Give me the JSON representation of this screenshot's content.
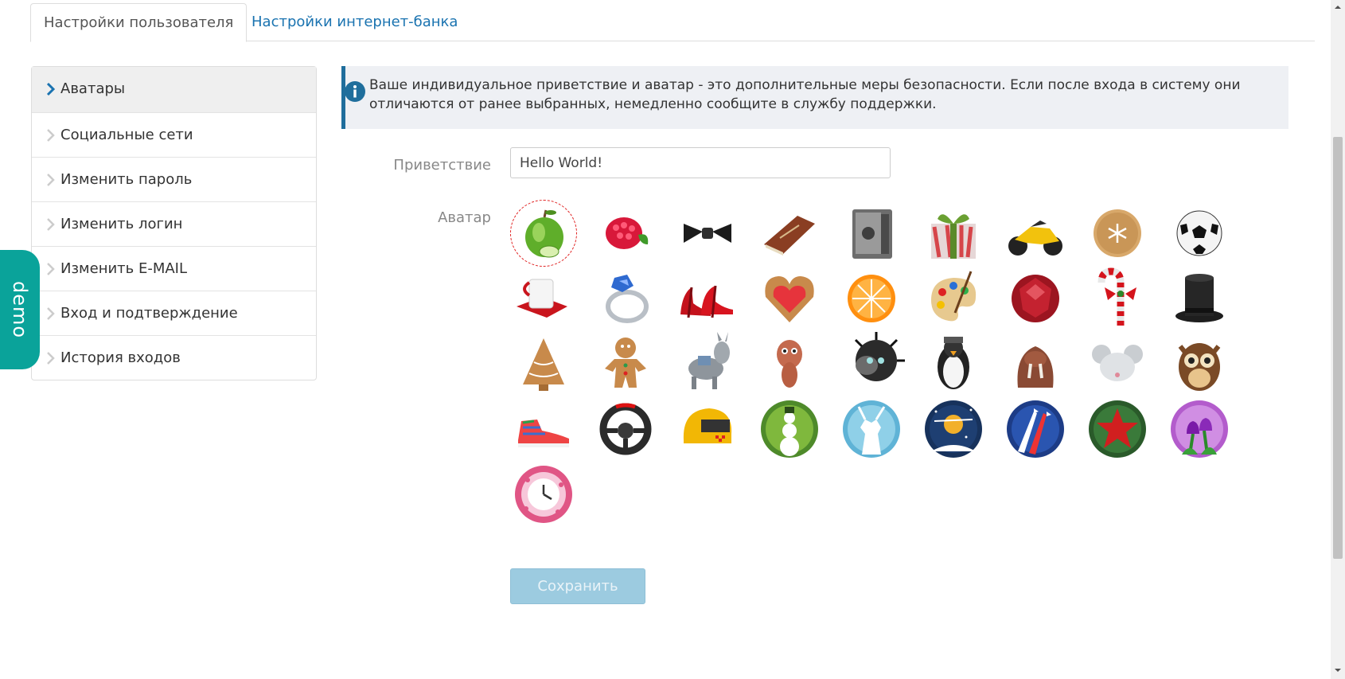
{
  "tabs": [
    {
      "label": "Настройки пользователя",
      "active": true
    },
    {
      "label": "Настройки интернет-банка",
      "active": false
    }
  ],
  "sidebar": {
    "items": [
      {
        "label": "Аватары",
        "active": true
      },
      {
        "label": "Социальные сети"
      },
      {
        "label": "Изменить пароль"
      },
      {
        "label": "Изменить логин"
      },
      {
        "label": "Изменить E-MAIL"
      },
      {
        "label": "Вход и подтверждение"
      },
      {
        "label": "История входов"
      }
    ]
  },
  "demo_label": "demo",
  "info": {
    "text": "Ваше индивидуальное приветствие и аватар - это дополнительные меры безопасности. Если после входа в систему они отличаются от ранее выбранных, немедленно сообщите в службу поддержки."
  },
  "form": {
    "greeting_label": "Приветствие",
    "greeting_value": "Hello World!",
    "avatar_label": "Аватар",
    "save_label": "Сохранить"
  },
  "avatars": [
    {
      "name": "apple",
      "selected": true
    },
    {
      "name": "raspberry"
    },
    {
      "name": "bow-tie"
    },
    {
      "name": "book"
    },
    {
      "name": "safe"
    },
    {
      "name": "gift"
    },
    {
      "name": "motorcycle"
    },
    {
      "name": "cookie"
    },
    {
      "name": "soccer-ball"
    },
    {
      "name": "cup"
    },
    {
      "name": "ring"
    },
    {
      "name": "high-heels"
    },
    {
      "name": "heart-cookie"
    },
    {
      "name": "orange"
    },
    {
      "name": "palette"
    },
    {
      "name": "ruby"
    },
    {
      "name": "candy-cane"
    },
    {
      "name": "top-hat"
    },
    {
      "name": "gingerbread-tree"
    },
    {
      "name": "gingerbread-man"
    },
    {
      "name": "donkey"
    },
    {
      "name": "squirrel"
    },
    {
      "name": "hedgehog"
    },
    {
      "name": "penguin"
    },
    {
      "name": "walrus"
    },
    {
      "name": "mouse"
    },
    {
      "name": "owl"
    },
    {
      "name": "sneaker"
    },
    {
      "name": "steering-wheel"
    },
    {
      "name": "helmet"
    },
    {
      "name": "snowman"
    },
    {
      "name": "deer"
    },
    {
      "name": "santa-sleigh"
    },
    {
      "name": "aerobatics"
    },
    {
      "name": "red-star"
    },
    {
      "name": "tulips"
    },
    {
      "name": "clock"
    }
  ],
  "colors": {
    "accent": "#1a73b0",
    "info_border": "#1f6e9c",
    "demo": "#0aa39a",
    "button_disabled": "#9ccbe0"
  }
}
